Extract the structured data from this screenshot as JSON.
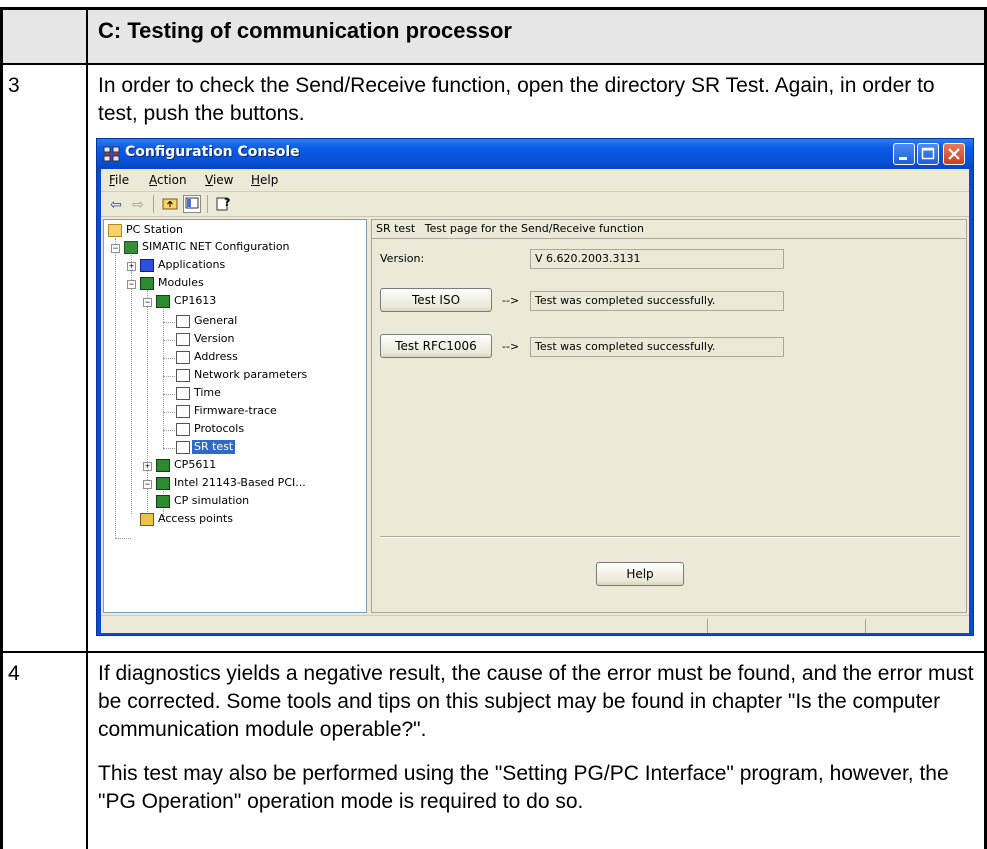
{
  "table": {
    "header": "C: Testing of communication processor",
    "rows": [
      {
        "step": "3",
        "text": "In order to check the Send/Receive function, open the directory SR Test. Again, in order to test, push the buttons."
      },
      {
        "step": "4",
        "paragraphs": [
          "If diagnostics yields a negative result, the cause of the error must be found, and the error must be corrected. Some tools and tips on this subject may be found in chapter \"Is the computer communication module operable?\".",
          "This test may also be performed using the \"Setting PG/PC Interface\" program, however, the \"PG Operation\" operation mode is required to do so."
        ]
      }
    ]
  },
  "window": {
    "title": "Configuration Console",
    "menu": [
      {
        "label": "File",
        "u": "F",
        "rest": "ile"
      },
      {
        "label": "Action",
        "u": "A",
        "rest": "ction"
      },
      {
        "label": "View",
        "u": "V",
        "rest": "iew"
      },
      {
        "label": "Help",
        "u": "H",
        "rest": "elp"
      }
    ],
    "toolbar_icons": [
      "back-arrow-icon",
      "forward-arrow-icon",
      "up-folder-icon",
      "show-tree-icon",
      "help-icon"
    ],
    "tree": {
      "root": "PC Station",
      "simatic": "SIMATIC NET Configuration",
      "applications": "Applications",
      "modules": "Modules",
      "cp1613": "CP1613",
      "cp1613_children": [
        "General",
        "Version",
        "Address",
        "Network parameters",
        "Time",
        "Firmware-trace",
        "Protocols",
        "SR test"
      ],
      "cp5611": "CP5611",
      "intel": "Intel 21143-Based PCI...",
      "cp_simulation": "CP simulation",
      "access_points": "Access points"
    },
    "panel": {
      "header_name": "SR test",
      "header_desc": "Test page for the Send/Receive function",
      "version_label": "Version:",
      "version_value": "V 6.620.2003.3131",
      "test_iso_label": "Test ISO",
      "test_iso_arrow": "-->",
      "test_iso_result": "Test was completed successfully.",
      "test_rfc_label": "Test RFC1006",
      "test_rfc_arrow": "-->",
      "test_rfc_result": "Test was completed successfully.",
      "help_label": "Help"
    }
  }
}
